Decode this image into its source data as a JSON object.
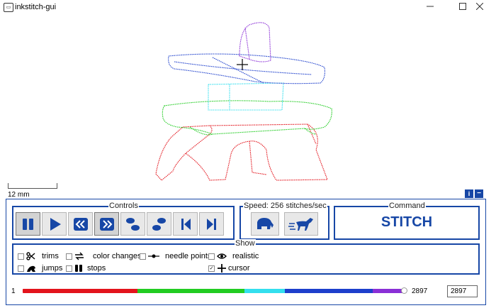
{
  "window": {
    "title": "inkstitch-gui",
    "minimize_icon": "minimize-icon",
    "maximize_icon": "maximize-icon",
    "close_icon": "close-icon"
  },
  "canvas": {
    "scale_label": "12 mm",
    "cursor_icon": "crosshair-icon"
  },
  "panel_buttons": {
    "info_icon": "info-icon",
    "info_label": "i",
    "collapse_icon": "minus-icon",
    "collapse_label": "−"
  },
  "controls": {
    "legend": "Controls",
    "buttons": [
      {
        "icon": "pause-icon",
        "pressed": true
      },
      {
        "icon": "play-icon",
        "pressed": false
      },
      {
        "icon": "rewind-icon",
        "pressed": false
      },
      {
        "icon": "fast-forward-icon",
        "pressed": true
      },
      {
        "icon": "step-backward-footprints-icon",
        "pressed": false
      },
      {
        "icon": "step-forward-footprints-icon",
        "pressed": false
      },
      {
        "icon": "skip-to-start-icon",
        "pressed": false
      },
      {
        "icon": "skip-to-end-icon",
        "pressed": false
      }
    ]
  },
  "speed": {
    "legend": "Speed: 256 stitches/sec",
    "buttons": [
      {
        "icon": "slow-elephant-icon"
      },
      {
        "icon": "fast-horse-icon"
      }
    ]
  },
  "command": {
    "legend": "Command",
    "value": "STITCH"
  },
  "show": {
    "legend": "Show",
    "options": [
      {
        "label": "trims",
        "icon": "scissors-icon",
        "checked": false
      },
      {
        "label": "color changes",
        "icon": "color-change-icon",
        "checked": false
      },
      {
        "label": "needle points",
        "icon": "needle-point-icon",
        "checked": false
      },
      {
        "label": "realistic",
        "icon": "eye-icon",
        "checked": false
      },
      {
        "label": "jumps",
        "icon": "jump-frog-icon",
        "checked": false
      },
      {
        "label": "stops",
        "icon": "stop-icon",
        "checked": false
      },
      {
        "label": "cursor",
        "icon": "cursor-cross-icon",
        "checked": true
      }
    ]
  },
  "slider": {
    "min": "1",
    "max": "2897",
    "value": "2897",
    "position_fraction": 1.0,
    "color_segments": [
      {
        "color": "#e3141c",
        "fraction": 0.3
      },
      {
        "color": "#22cc22",
        "fraction": 0.28
      },
      {
        "color": "#33dfee",
        "fraction": 0.105
      },
      {
        "color": "#1d3fcc",
        "fraction": 0.23
      },
      {
        "color": "#8a2fd6",
        "fraction": 0.085
      }
    ]
  },
  "colors": {
    "accent": "#1747a6",
    "red_thread": "#e3141c",
    "green_thread": "#22cc22",
    "cyan_thread": "#33dfee",
    "blue_thread": "#1d3fcc",
    "purple_thread": "#8a2fd6"
  }
}
